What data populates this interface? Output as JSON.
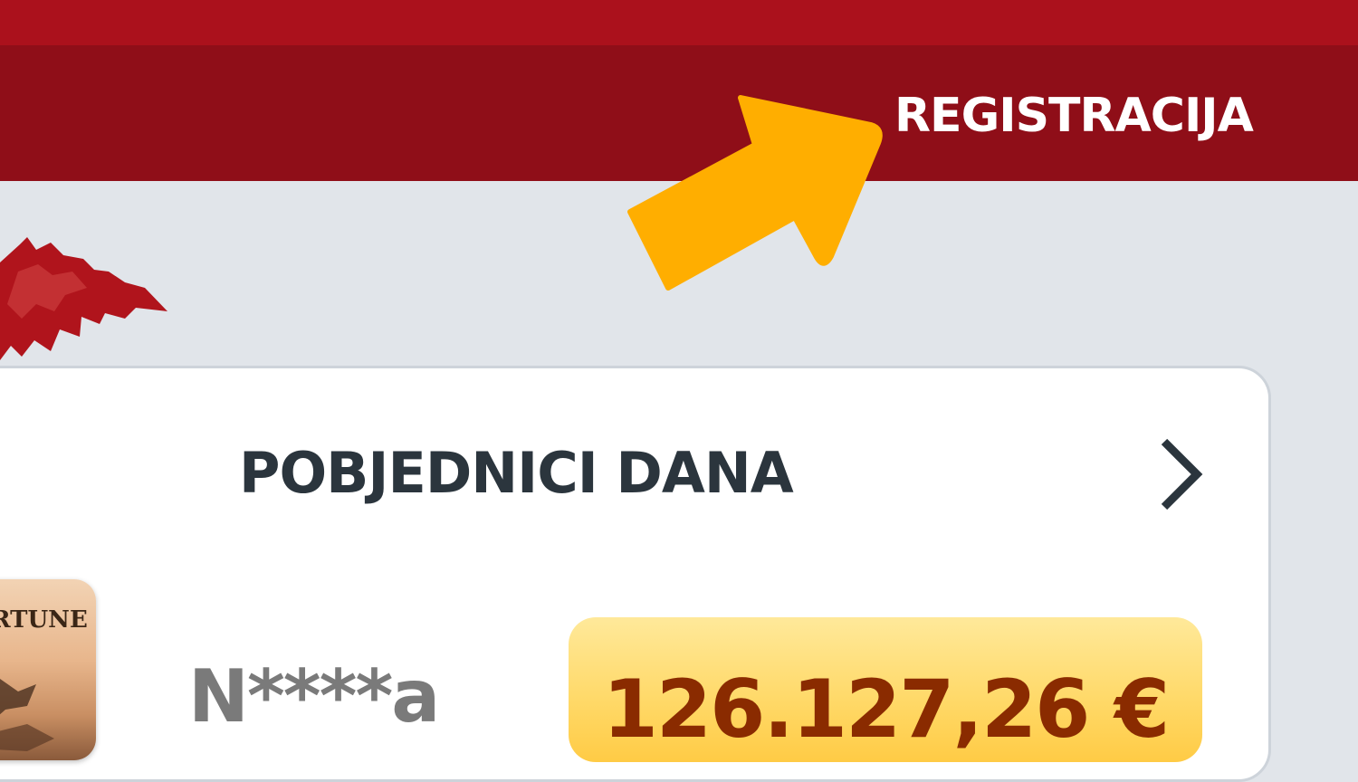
{
  "header": {
    "register_label": "REGISTRACIJA"
  },
  "winners": {
    "title": "POBJEDNICI DANA",
    "items": [
      {
        "game_title": "RTUNE",
        "name": "N****a",
        "amount": "126.127,26 €"
      }
    ]
  },
  "icons": {
    "arrow": "pointer-arrow-icon",
    "next": "chevron-right-icon"
  },
  "colors": {
    "top_strip": "#ab111c",
    "header_bar": "#8f0e18",
    "arrow": "#ffae00",
    "page_bg": "#e1e5ea",
    "title_text": "#2b353d",
    "amount_text": "#8a2b00",
    "amount_bg": "#ffd866"
  }
}
